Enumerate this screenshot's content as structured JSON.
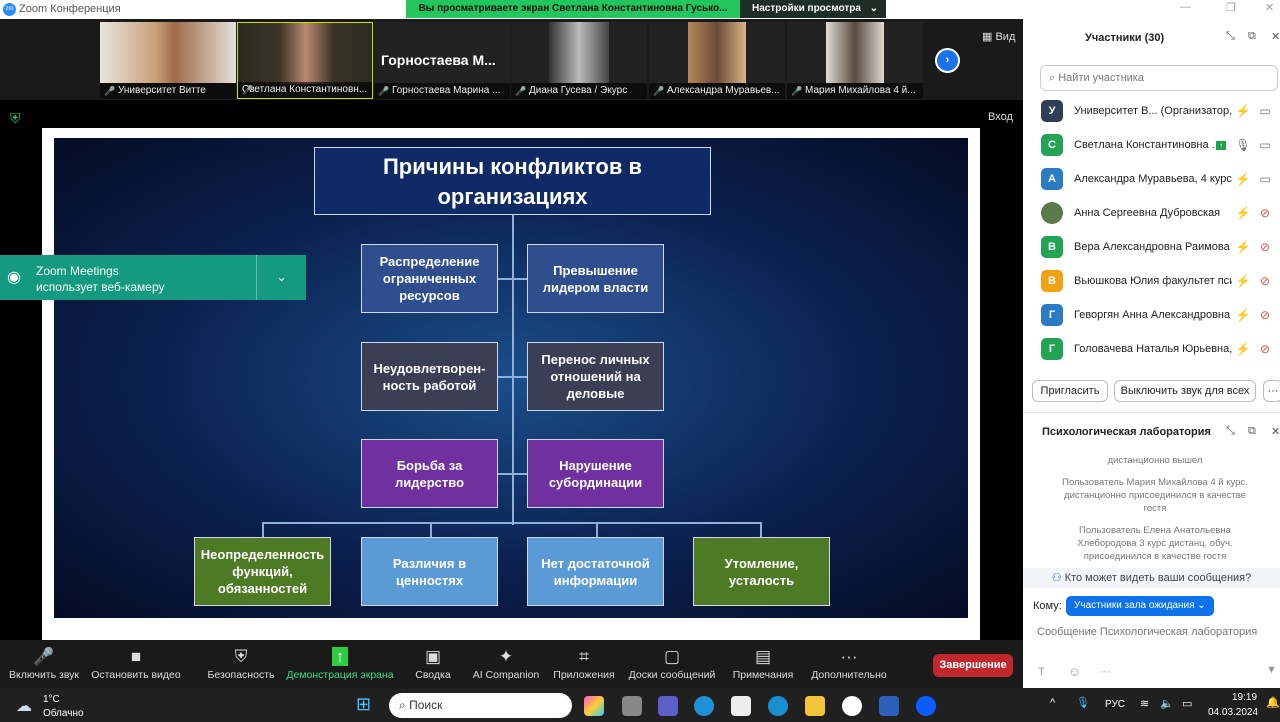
{
  "window": {
    "title": "Zoom Конференция",
    "banner": "Вы просматриваете экран Светлана Константиновна Гусько...",
    "view_settings": "Настройки просмотра",
    "view": "Вид",
    "enter": "Вход"
  },
  "thumbnails": [
    {
      "name": "Университет Витте"
    },
    {
      "name": "Светлана Константиновн..."
    },
    {
      "name": "Горностаева Марина ...",
      "big_name": "Горностаева  М..."
    },
    {
      "name": "Диана Гусева / Экурс"
    },
    {
      "name": "Александра Муравьев..."
    },
    {
      "name": "Мария Михайлова 4 й..."
    }
  ],
  "slide": {
    "title": "Причины конфликтов в организациях",
    "boxes": [
      "Распределение ограниченных ресурсов",
      "Превышение лидером власти",
      "Неудовлетворен-ность работой",
      "Перенос личных отношений на деловые",
      "Борьба за лидерство",
      "Нарушение субординации",
      "Неопределенность функций, обязанностей",
      "Различия в ценностях",
      "Нет достаточной информации",
      "Утомление, усталость"
    ],
    "colors": {
      "blue": "#2f4e8e",
      "dark": "#3a3f55",
      "purple": "#7030a0",
      "green": "#4e7a26",
      "light": "#5b9bd5"
    }
  },
  "notification": {
    "title": "Zoom Meetings",
    "text": "использует веб-камеру"
  },
  "participants": {
    "title": "Участники (30)",
    "search_placeholder": "Найти участника",
    "list": [
      {
        "initial": "У",
        "name": "Университет В... (Организатор, я)",
        "color": "#2d3e55"
      },
      {
        "initial": "С",
        "name": "Светлана Константиновна ...",
        "color": "#23a455"
      },
      {
        "initial": "А",
        "name": "Александра Муравьева, 4 курс, ...",
        "color": "#2b7bc4"
      },
      {
        "initial": "",
        "name": "Анна Сергеевна Дубровская",
        "color": "#5a7a4a"
      },
      {
        "initial": "В",
        "name": "Вера Александровна Раимова ...",
        "color": "#23a455"
      },
      {
        "initial": "В",
        "name": "Вьюшкова Юлия факультет пси...",
        "color": "#f2a116"
      },
      {
        "initial": "Г",
        "name": "Геворгян Анна Александровна",
        "color": "#2b7bc4"
      },
      {
        "initial": "Г",
        "name": "Головачева Наталья Юрьевна, ...",
        "color": "#23a455"
      }
    ],
    "invite": "Пригласить",
    "mute_all": "Выключить звук для всех",
    "more": "···"
  },
  "chat": {
    "title": "Психологическая лаборатория",
    "messages": [
      "дистанционно вышел",
      "Пользователь Мария Михайлова 4 й курс. дистанционно присоединился в качестве гостя",
      "Пользователь Елена Анатольевна Хлебородова 3 курс дистанц. обуч. присоединился в качестве гостя"
    ],
    "who_can_see": "Кто может видеть ваши сообщения?",
    "to_label": "Кому:",
    "to_value": "Участники зала ожидания",
    "placeholder": "Сообщение Психологическая лаборатория"
  },
  "toolbar": {
    "items": [
      "Включить звук",
      "Остановить видео",
      "Безопасность",
      "Демонстрация экрана",
      "Сводка",
      "AI Companion",
      "Приложения",
      "Доски сообщений",
      "Примечания",
      "Дополнительно"
    ],
    "end": "Завершение"
  },
  "taskbar": {
    "temp": "1°C",
    "weather": "Облачно",
    "search": "Поиск",
    "lang": "РУС",
    "time": "19:19",
    "date": "04.03.2024"
  }
}
